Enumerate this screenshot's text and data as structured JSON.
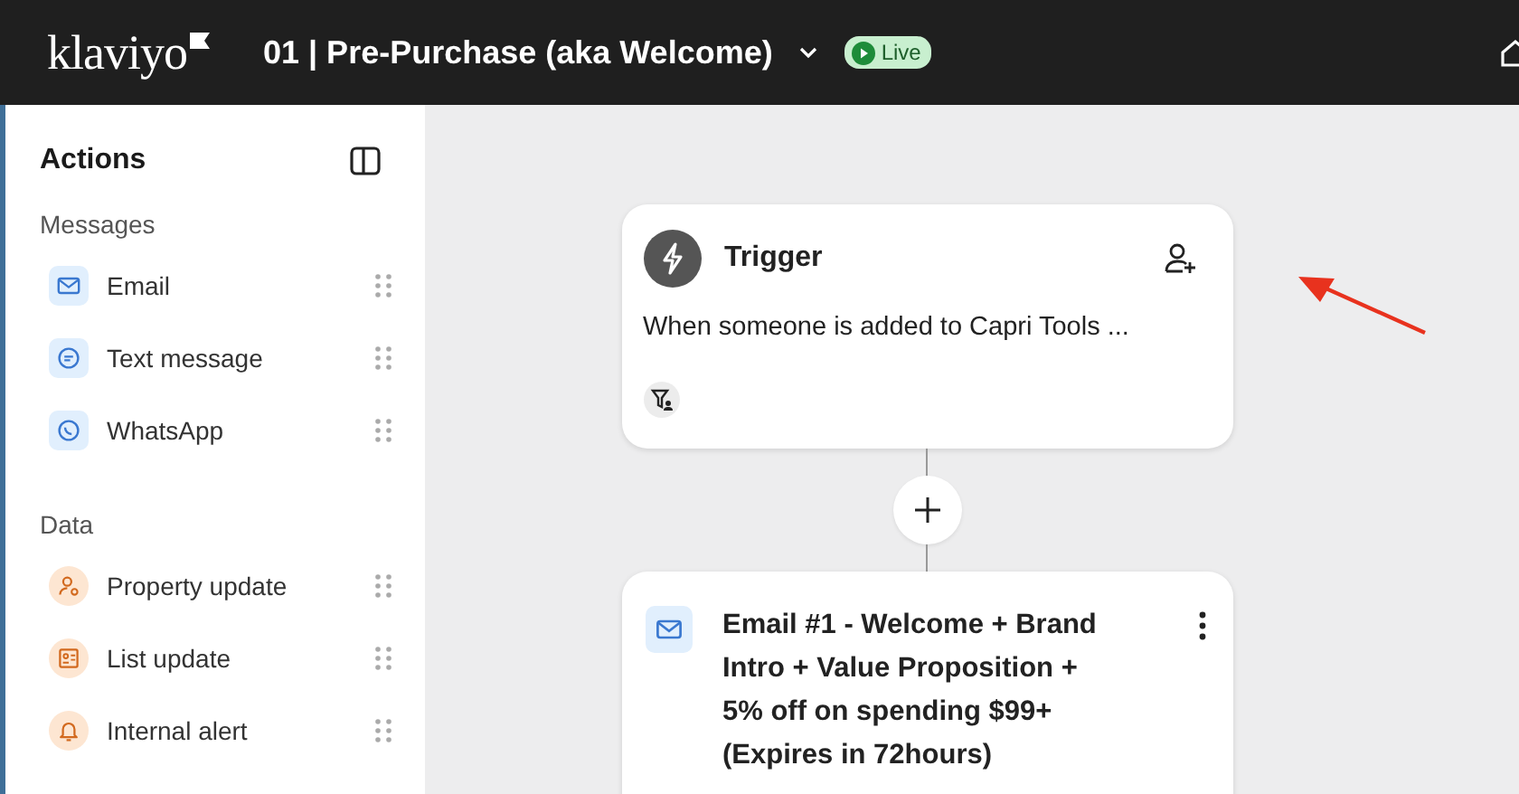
{
  "header": {
    "logo": "klaviyo",
    "flow_title": "01 | Pre-Purchase (aka Welcome)",
    "status": "Live"
  },
  "sidebar": {
    "title": "Actions",
    "sections": [
      {
        "heading": "Messages",
        "kind": "message",
        "items": [
          {
            "label": "Email",
            "kind": "email"
          },
          {
            "label": "Text message",
            "kind": "sms"
          },
          {
            "label": "WhatsApp",
            "kind": "whatsapp"
          }
        ]
      },
      {
        "heading": "Data",
        "kind": "data",
        "items": [
          {
            "label": "Property update",
            "kind": "person"
          },
          {
            "label": "List update",
            "kind": "list"
          },
          {
            "label": "Internal alert",
            "kind": "bell"
          }
        ]
      }
    ]
  },
  "canvas": {
    "trigger": {
      "title": "Trigger",
      "description": "When someone is added to Capri Tools ..."
    },
    "email_step": {
      "title": "Email #1 - Welcome + Brand Intro + Value Proposition + 5% off on spending $99+ (Expires in 72hours)"
    }
  }
}
